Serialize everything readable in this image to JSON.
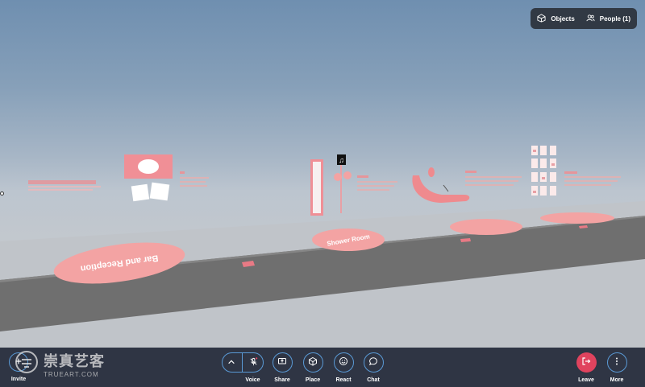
{
  "topbar": {
    "objects_label": "Objects",
    "people_label": "People (1)"
  },
  "toolbar": {
    "invite_label": "Invite",
    "voice_label": "Voice",
    "share_label": "Share",
    "place_label": "Place",
    "react_label": "React",
    "chat_label": "Chat",
    "leave_label": "Leave",
    "more_label": "More"
  },
  "scene": {
    "pad1_text": "Bar and Reception",
    "pad2_text": "Shower Room",
    "pad3_text": "",
    "pad4_text": ""
  },
  "watermark": {
    "main": "崇真艺客",
    "sub": "TRUEART.COM"
  },
  "colors": {
    "toolbar_bg": "#2f3544",
    "accent_blue": "#5a9ad6",
    "leave_red": "#e0435e",
    "pad_pink": "#f3a3a3",
    "floor_gray": "#707070"
  }
}
